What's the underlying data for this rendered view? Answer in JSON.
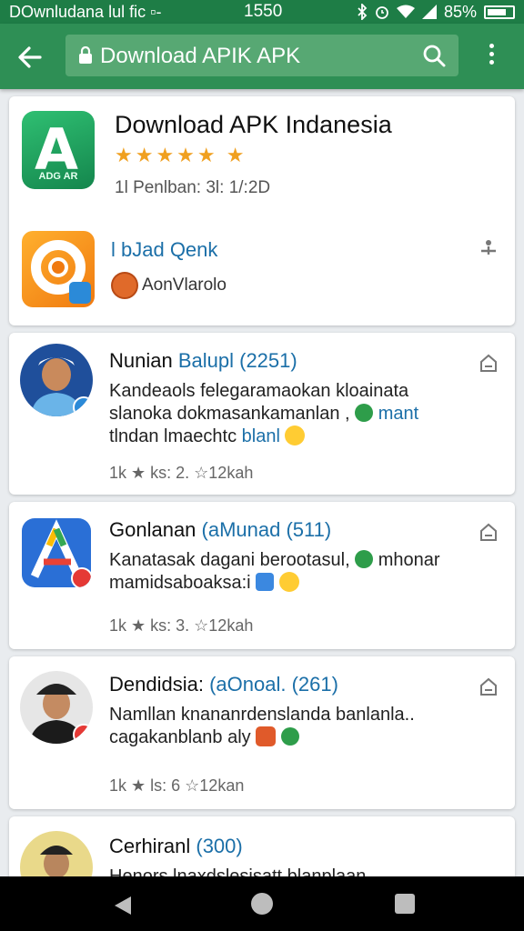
{
  "status_bar": {
    "left_text": "DOwnludana lul  ﬁc  ▫-",
    "time": "1550",
    "battery": "85%"
  },
  "app_bar": {
    "search_text": "Download APIK APK"
  },
  "header_card": {
    "app_name": "Download APK Indanesia",
    "stars": "★★★★★ ★",
    "icon_subtext": "ADG AR",
    "meta": "1l  Penlban: 3l: 1/:2D",
    "link_text": "l bJad Qenk",
    "author": "AonVlarolo"
  },
  "posts": [
    {
      "title": "Nunian ",
      "title_highlight": "Balupl (2251)",
      "body_line1": "Kandeaols felegaramaokan kloainata",
      "body_line2": "slanoka dokmasankamanlan ,",
      "body_line2_tail": "mant",
      "body_line3": "tlndan lmaechtc ",
      "body_line3_blue": "blanl",
      "stats": "1k ★ ks: 2.   ☆12kah",
      "avatar_bg": "#1f4f9b"
    },
    {
      "title": "Gonlanan ",
      "title_highlight": "(aMunad (511)",
      "body_line1": "Kanatasak dagani berootasul,",
      "body_line1_tail": "mhonar",
      "body_line2": "mamidsaboaksa:i",
      "stats": "1k ★ ks: 3.   ☆12kah",
      "avatar_bg": "#2a6fd6"
    },
    {
      "title": "Dendidsia: ",
      "title_highlight": "(aOnoal. (261)",
      "body_line1": "Namllan knananrdenslanda banlanla..",
      "body_line2": "cagakanblanb aly",
      "stats": "1k ★ ls: 6    ☆12kan",
      "avatar_bg": "#e6e6e6"
    },
    {
      "title": "Cerhiranl ",
      "title_highlight": "(300)",
      "body_line1": "Henors lnaxdslesisatt blanplaan",
      "avatar_bg": "#e9d98a"
    }
  ]
}
